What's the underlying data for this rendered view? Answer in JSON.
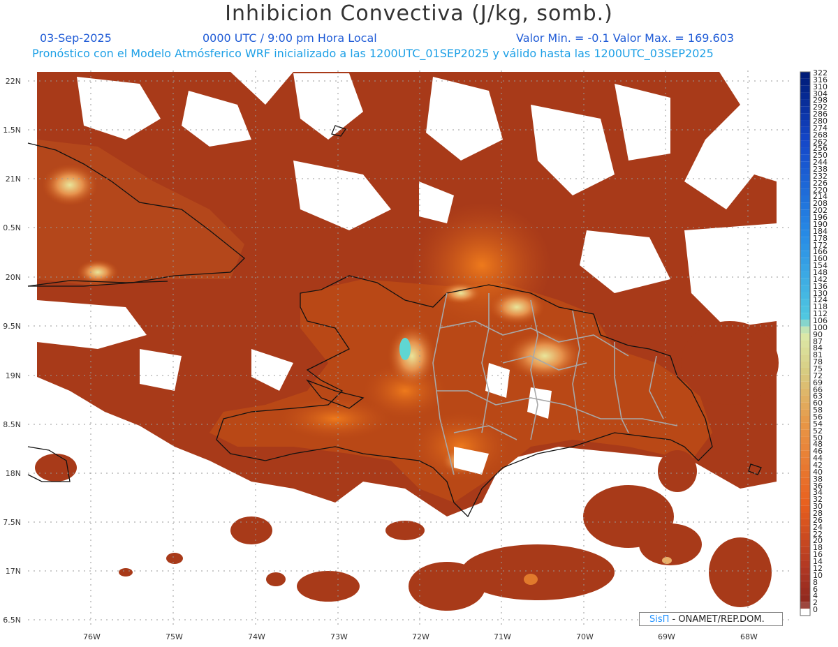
{
  "header": {
    "title": "Inhibicion Convectiva (J/kg, somb.)",
    "date": "03-Sep-2025",
    "time": "0000 UTC / 9:00 pm Hora Local",
    "min_max": "Valor Min. = -0.1  Valor Max. = 169.603",
    "model_info": "Pronóstico con el Modelo Atmósferico WRF inicializado a las 1200UTC_01SEP2025 y válido hasta las  1200UTC_03SEP2025"
  },
  "axes": {
    "lat_labels": [
      "22N",
      "1.5N",
      "21N",
      "0.5N",
      "20N",
      "9.5N",
      "19N",
      "8.5N",
      "18N",
      "7.5N",
      "17N",
      "6.5N"
    ],
    "lon_labels": [
      "76W",
      "75W",
      "74W",
      "73W",
      "72W",
      "71W",
      "70W",
      "69W",
      "68W"
    ]
  },
  "colorbar": {
    "labels": [
      "322",
      "316",
      "310",
      "304",
      "298",
      "292",
      "286",
      "280",
      "274",
      "268",
      "262",
      "256",
      "250",
      "244",
      "238",
      "232",
      "226",
      "220",
      "214",
      "208",
      "202",
      "196",
      "190",
      "184",
      "178",
      "172",
      "166",
      "160",
      "154",
      "148",
      "142",
      "136",
      "130",
      "124",
      "118",
      "112",
      "106",
      "100",
      "90",
      "87",
      "84",
      "81",
      "78",
      "75",
      "72",
      "69",
      "66",
      "63",
      "60",
      "58",
      "56",
      "54",
      "52",
      "50",
      "48",
      "46",
      "44",
      "42",
      "40",
      "38",
      "36",
      "34",
      "32",
      "30",
      "28",
      "26",
      "24",
      "22",
      "20",
      "18",
      "16",
      "14",
      "12",
      "10",
      "8",
      "6",
      "4",
      "2",
      "0"
    ]
  },
  "credit": {
    "logo": "SisΠ",
    "text": " - ONAMET/REP.DOM."
  },
  "colors": {
    "field_dark": "#9b3318",
    "field_mid": "#bf4a12",
    "field_orange": "#e06a18",
    "field_light": "#e9a55c",
    "field_pale": "#dfe6a6",
    "field_cyan": "#5fd6d2",
    "coast": "#111111",
    "borders": "#aaaaaa",
    "grid": "#999999"
  }
}
